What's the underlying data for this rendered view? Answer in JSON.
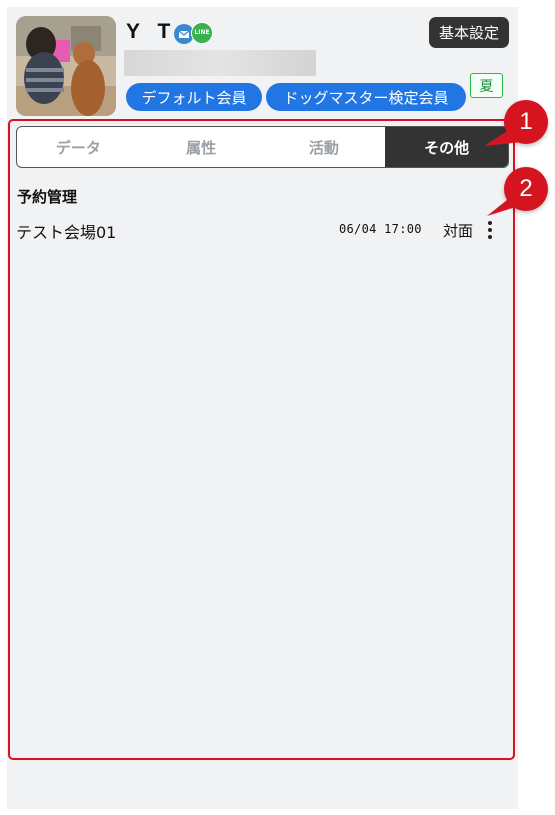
{
  "profile": {
    "name": "Y T",
    "line_icon_text": "LINE",
    "basic_settings_label": "基本設定",
    "memberships": [
      "デフォルト会員",
      "ドッグマスター検定会員"
    ],
    "season_badge": "夏"
  },
  "tabs": [
    {
      "label": "データ",
      "active": false
    },
    {
      "label": "属性",
      "active": false
    },
    {
      "label": "活動",
      "active": false
    },
    {
      "label": "その他",
      "active": true
    }
  ],
  "reservation_section": {
    "title": "予約管理",
    "rows": [
      {
        "venue": "テスト会場01",
        "datetime": "06/04 17:00",
        "type": "対面"
      }
    ]
  },
  "callouts": [
    "1",
    "2"
  ],
  "colors": {
    "accent_blue": "#2176e4",
    "dark_button": "#333333",
    "highlight_red": "#d9101f",
    "season_green": "#2db84d"
  }
}
